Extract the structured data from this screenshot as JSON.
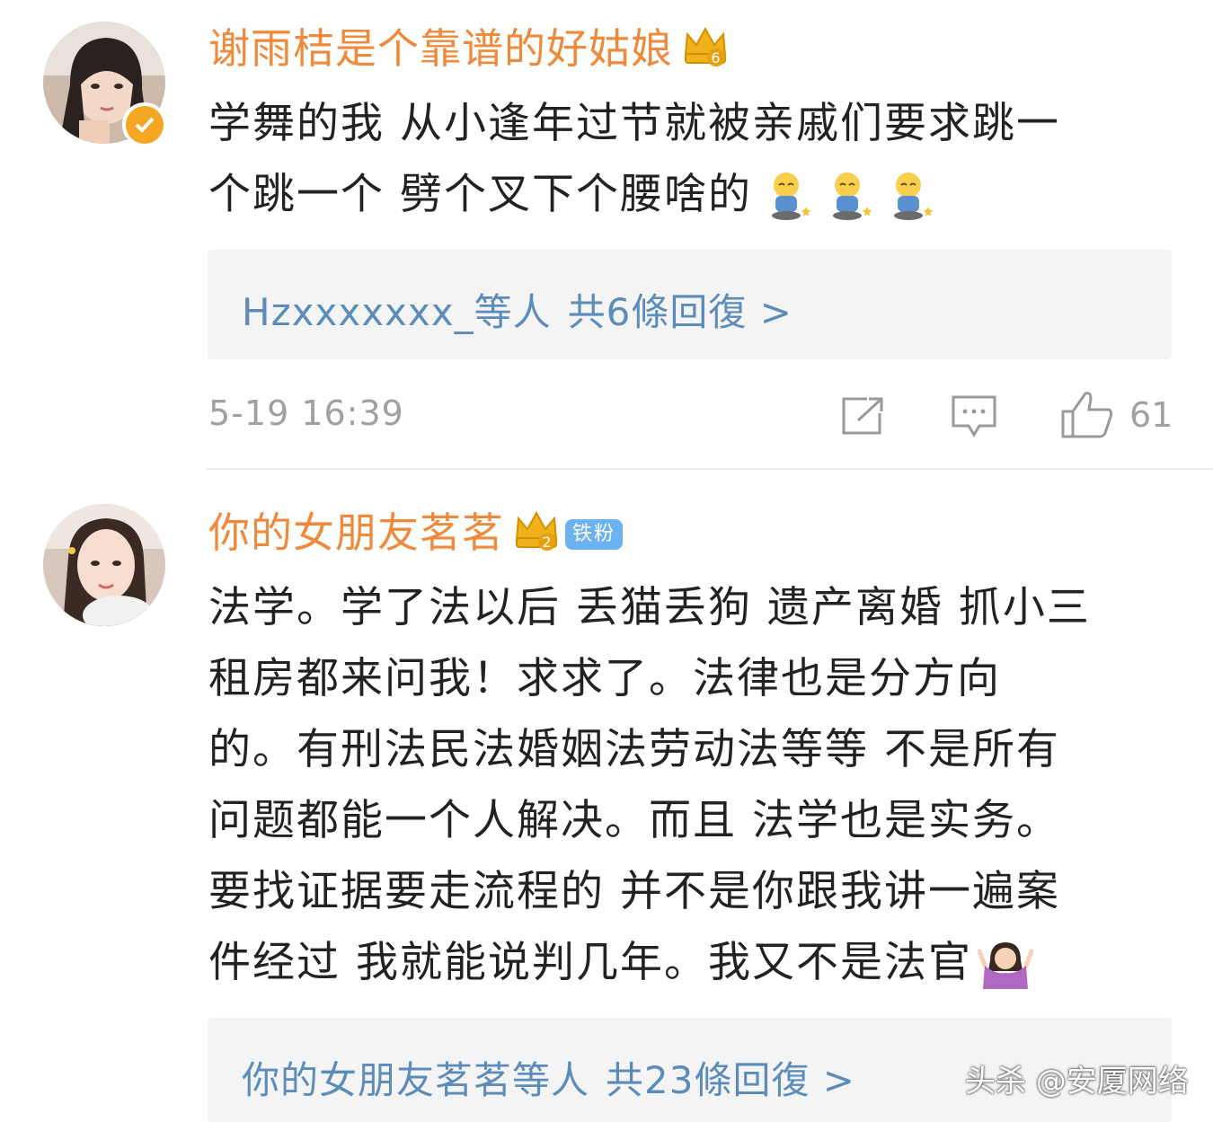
{
  "comments": [
    {
      "username": "谢雨桔是个靠谱的好姑娘",
      "crown_level": "6",
      "text_line1": "学舞的我 从小逢年过节就被亲戚们要求跳一",
      "text_line2": "个跳一个 劈个叉下个腰啥的",
      "emojis": [
        "doge-sitting-emoji",
        "doge-sitting-emoji",
        "doge-sitting-emoji"
      ],
      "reply_prefix": "Hzxxxxxxx_等人",
      "reply_count": "共6條回復 >",
      "timestamp": "5-19 16:39",
      "like_count": "61",
      "verified": true
    },
    {
      "username": "你的女朋友茗茗",
      "crown_level": "2",
      "badge": "铁粉",
      "lines": [
        "法学。学了法以后 丢猫丢狗 遗产离婚 抓小三",
        "租房都来问我！求求了。法律也是分方向",
        "的。有刑法民法婚姻法劳动法等等 不是所有",
        "问题都能一个人解决。而且 法学也是实务。",
        "要找证据要走流程的 并不是你跟我讲一遍案",
        "件经过 我就能说判几年。我又不是法官"
      ],
      "reply_prefix": "你的女朋友茗茗等人",
      "reply_count": "共23條回復 >"
    }
  ],
  "watermark": "头杀 @安厦网络",
  "colors": {
    "username": "#ef8a3c",
    "reply_link": "#5b8cba",
    "meta": "#a0a0a0",
    "reply_bg": "#f4f4f4",
    "badge": "#6bb2f2"
  }
}
